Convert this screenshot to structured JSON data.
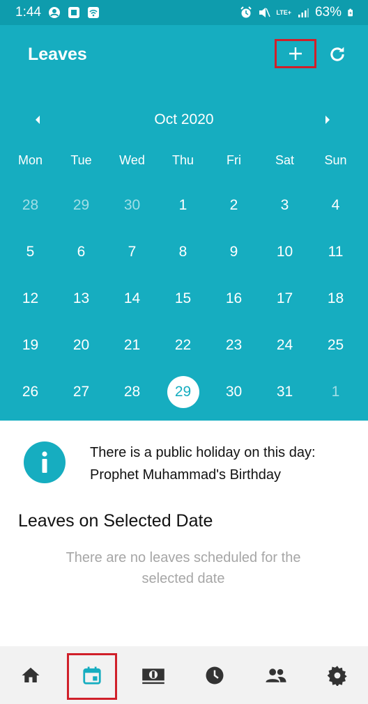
{
  "status_bar": {
    "time": "1:44",
    "network": "LTE+",
    "battery": "63%"
  },
  "header": {
    "title": "Leaves"
  },
  "calendar": {
    "month_label": "Oct 2020",
    "weekdays": [
      "Mon",
      "Tue",
      "Wed",
      "Thu",
      "Fri",
      "Sat",
      "Sun"
    ],
    "weeks": [
      [
        "28",
        "29",
        "30",
        "1",
        "2",
        "3",
        "4"
      ],
      [
        "5",
        "6",
        "7",
        "8",
        "9",
        "10",
        "11"
      ],
      [
        "12",
        "13",
        "14",
        "15",
        "16",
        "17",
        "18"
      ],
      [
        "19",
        "20",
        "21",
        "22",
        "23",
        "24",
        "25"
      ],
      [
        "26",
        "27",
        "28",
        "29",
        "30",
        "31",
        "1"
      ]
    ],
    "selected_day": "29"
  },
  "holiday": {
    "line1": "There is a public holiday on this day:",
    "line2": "Prophet Muhammad's Birthday"
  },
  "leaves": {
    "title": "Leaves on Selected Date",
    "empty_line1": "There are no leaves scheduled for the",
    "empty_line2": "selected date"
  },
  "nav": {
    "items": [
      {
        "icon": "home-icon"
      },
      {
        "icon": "calendar-icon"
      },
      {
        "icon": "money-icon"
      },
      {
        "icon": "clock-icon"
      },
      {
        "icon": "people-icon"
      },
      {
        "icon": "gear-icon"
      }
    ],
    "active_index": 1
  },
  "colors": {
    "primary": "#16adc0",
    "status_bar": "#0e9cad",
    "highlight": "#d0202a"
  }
}
